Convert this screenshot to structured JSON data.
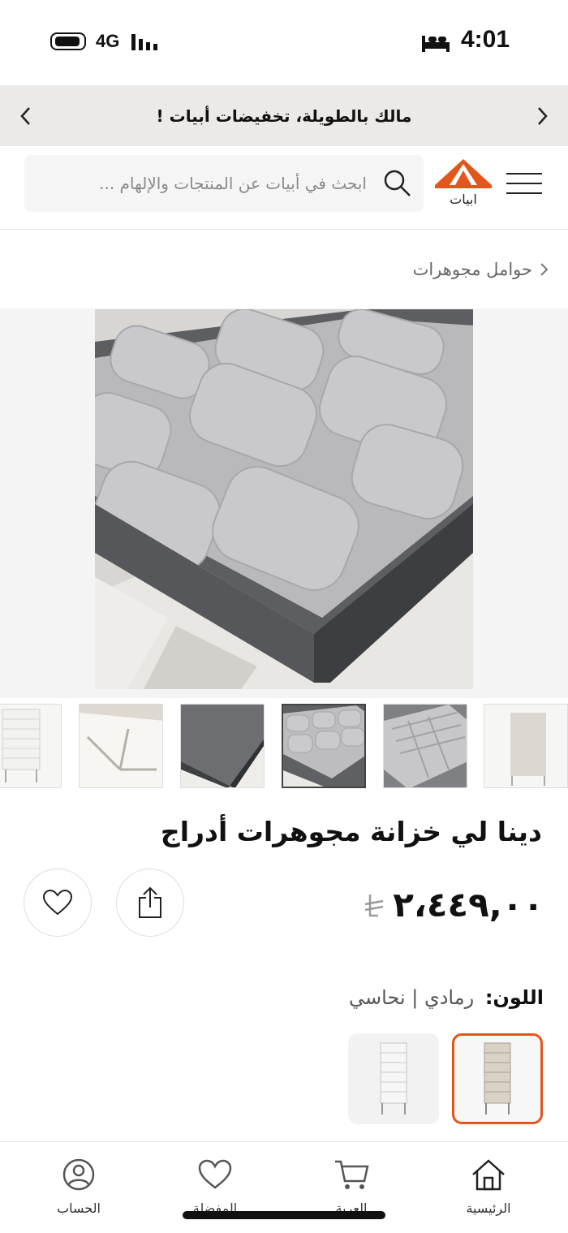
{
  "status_bar": {
    "time": "4:01",
    "network": "4G"
  },
  "promo": {
    "text": "مالك بالطويلة، تخفيضات أبيات !"
  },
  "header": {
    "search_placeholder": "ابحث في أبيات عن المنتجات والإلهام ...",
    "logo_text": "ابيات"
  },
  "breadcrumb": {
    "label": "حوامل مجوهرات"
  },
  "product": {
    "title": "دينا لي خزانة مجوهرات أدراج",
    "price": "٢،٤٤٩,٠٠",
    "color_label": "اللون:",
    "color_value": "رمادي | نحاسي"
  },
  "bottom_nav": {
    "items": [
      {
        "label": "الرئيسية",
        "icon": "home-icon"
      },
      {
        "label": "العربة",
        "icon": "cart-icon"
      },
      {
        "label": "المفضلة",
        "icon": "heart-icon"
      },
      {
        "label": "الحساب",
        "icon": "user-icon"
      }
    ]
  },
  "colors": {
    "accent": "#e2561c",
    "promo_bg": "#ece9e7",
    "text": "#111111",
    "muted": "#8a8a8a"
  }
}
